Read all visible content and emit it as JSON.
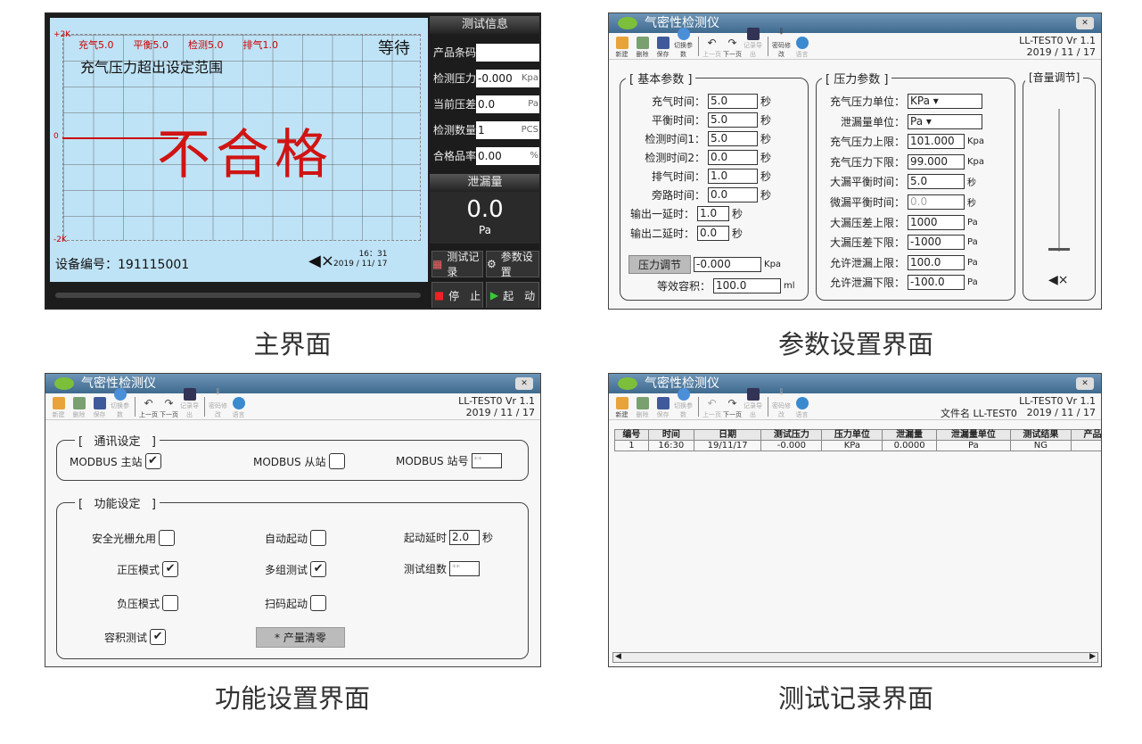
{
  "main": {
    "y_top": "+2K",
    "y_mid": "0",
    "y_bot": "-2K",
    "tags": [
      "充气5.0",
      "平衡5.0",
      "检测5.0",
      "排气1.0"
    ],
    "status": "等待",
    "message": "充气压力超出设定范围",
    "result": "不合格",
    "device_label": "设备编号：191115001",
    "time": "16：31",
    "date": "2019 / 11/ 17",
    "info_header": "测试信息",
    "fields": [
      {
        "label": "产品条码",
        "value": "",
        "unit": ""
      },
      {
        "label": "检测压力",
        "value": "-0.000",
        "unit": "Kpa"
      },
      {
        "label": "当前压差",
        "value": "0.0",
        "unit": "Pa"
      },
      {
        "label": "检测数量",
        "value": "1",
        "unit": "PCS"
      },
      {
        "label": "合格品率",
        "value": "0.00",
        "unit": "%"
      }
    ],
    "leak_header": "泄漏量",
    "leak_value": "0.0",
    "leak_unit": "Pa",
    "btn_record": "测试记录",
    "btn_settings": "参数设置",
    "btn_stop": "停　止",
    "btn_start": "起　动"
  },
  "window": {
    "title": "气密性检测仪",
    "model": "LL-TEST0  Vr 1.1",
    "date": "2019 / 11 / 17",
    "toolbar": [
      "新建",
      "删除",
      "保存",
      "切换参数",
      "上一页",
      "下一页",
      "记录导出",
      "密码修改",
      "语言"
    ]
  },
  "params": {
    "basic_title": "[ 基本参数 ]",
    "basic": [
      {
        "label": "充气时间：",
        "value": "5.0",
        "unit": "秒"
      },
      {
        "label": "平衡时间：",
        "value": "5.0",
        "unit": "秒"
      },
      {
        "label": "检测时间1：",
        "value": "5.0",
        "unit": "秒"
      },
      {
        "label": "检测时间2：",
        "value": "0.0",
        "unit": "秒"
      },
      {
        "label": "排气时间：",
        "value": "1.0",
        "unit": "秒"
      },
      {
        "label": "旁路时间：",
        "value": "0.0",
        "unit": "秒"
      },
      {
        "label": "输出一延时：",
        "value": "1.0",
        "unit": "秒"
      },
      {
        "label": "输出二延时：",
        "value": "0.0",
        "unit": "秒"
      }
    ],
    "pressure_btn": "压力调节",
    "pressure_val": "-0.000",
    "pressure_unit": "Kpa",
    "volume_label": "等效容积：",
    "volume_val": "100.0",
    "volume_unit": "ml",
    "press_title": "[ 压力参数 ]",
    "press": [
      {
        "label": "充气压力单位：",
        "value": "KPa ▾",
        "unit": ""
      },
      {
        "label": "泄漏量单位：",
        "value": "Pa ▾",
        "unit": ""
      },
      {
        "label": "充气压力上限：",
        "value": "101.000",
        "unit": "Kpa"
      },
      {
        "label": "充气压力下限：",
        "value": "99.000",
        "unit": "Kpa"
      },
      {
        "label": "大漏平衡时间：",
        "value": "5.0",
        "unit": "秒"
      },
      {
        "label": "微漏平衡时间：",
        "value": "0.0",
        "unit": "秒"
      },
      {
        "label": "大漏压差上限：",
        "value": "1000",
        "unit": "Pa"
      },
      {
        "label": "大漏压差下限：",
        "value": "-1000",
        "unit": "Pa"
      },
      {
        "label": "允许泄漏上限：",
        "value": "100.0",
        "unit": "Pa"
      },
      {
        "label": "允许泄漏下限：",
        "value": "-100.0",
        "unit": "Pa"
      }
    ],
    "volume_title": "[音量调节]"
  },
  "func": {
    "comm_title": "通讯设定",
    "master": "MODBUS 主站",
    "slave": "MODBUS 从站",
    "station": "MODBUS 站号",
    "station_ph": "**",
    "func_title": "功能设定",
    "items": [
      {
        "label": "安全光栅允用",
        "checked": ""
      },
      {
        "label": "自动起动",
        "checked": ""
      },
      {
        "label": "正压模式",
        "checked": "✔"
      },
      {
        "label": "多组测试",
        "checked": "✔"
      },
      {
        "label": "负压模式",
        "checked": ""
      },
      {
        "label": "扫码起动",
        "checked": ""
      },
      {
        "label": "容积测试",
        "checked": "✔"
      }
    ],
    "delay_label": "起动延时",
    "delay_val": "2.0",
    "delay_unit": "秒",
    "groups_label": "测试组数",
    "groups_ph": "**",
    "clear_btn": "* 产量清零",
    "master_check": "✔"
  },
  "records": {
    "filename": "文件名 LL-TEST0",
    "headers": [
      "编号",
      "时间",
      "日期",
      "测试压力",
      "压力单位",
      "泄漏量",
      "泄漏量单位",
      "测试结果",
      "产品条码"
    ],
    "rows": [
      [
        "1",
        "16:30",
        "19/11/17",
        "-0.000",
        "KPa",
        "0.0000",
        "Pa",
        "NG",
        ""
      ]
    ]
  },
  "captions": [
    "主界面",
    "参数设置界面",
    "功能设置界面",
    "测试记录界面"
  ]
}
